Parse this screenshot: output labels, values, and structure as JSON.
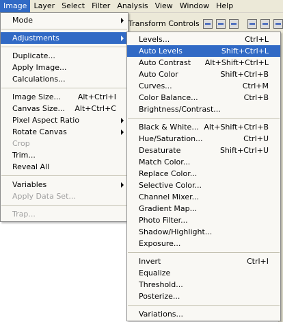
{
  "menubar": [
    {
      "label": "Image",
      "active": true
    },
    {
      "label": "Layer"
    },
    {
      "label": "Select"
    },
    {
      "label": "Filter"
    },
    {
      "label": "Analysis"
    },
    {
      "label": "View"
    },
    {
      "label": "Window"
    },
    {
      "label": "Help"
    }
  ],
  "toolbar": {
    "transform_label": "Transform Controls"
  },
  "image_menu": [
    {
      "label": "Mode",
      "arrow": true
    },
    {
      "sep": true
    },
    {
      "label": "Adjustments",
      "arrow": true,
      "highlight": true
    },
    {
      "sep": true
    },
    {
      "label": "Duplicate..."
    },
    {
      "label": "Apply Image..."
    },
    {
      "label": "Calculations..."
    },
    {
      "sep": true
    },
    {
      "label": "Image Size...",
      "shortcut": "Alt+Ctrl+I"
    },
    {
      "label": "Canvas Size...",
      "shortcut": "Alt+Ctrl+C"
    },
    {
      "label": "Pixel Aspect Ratio",
      "arrow": true
    },
    {
      "label": "Rotate Canvas",
      "arrow": true
    },
    {
      "label": "Crop",
      "disabled": true
    },
    {
      "label": "Trim..."
    },
    {
      "label": "Reveal All"
    },
    {
      "sep": true
    },
    {
      "label": "Variables",
      "arrow": true
    },
    {
      "label": "Apply Data Set...",
      "disabled": true
    },
    {
      "sep": true
    },
    {
      "label": "Trap...",
      "disabled": true
    }
  ],
  "adjust_menu": [
    {
      "label": "Levels...",
      "shortcut": "Ctrl+L"
    },
    {
      "label": "Auto Levels",
      "shortcut": "Shift+Ctrl+L",
      "highlight": true
    },
    {
      "label": "Auto Contrast",
      "shortcut": "Alt+Shift+Ctrl+L"
    },
    {
      "label": "Auto Color",
      "shortcut": "Shift+Ctrl+B"
    },
    {
      "label": "Curves...",
      "shortcut": "Ctrl+M"
    },
    {
      "label": "Color Balance...",
      "shortcut": "Ctrl+B"
    },
    {
      "label": "Brightness/Contrast..."
    },
    {
      "sep": true
    },
    {
      "label": "Black & White...",
      "shortcut": "Alt+Shift+Ctrl+B"
    },
    {
      "label": "Hue/Saturation...",
      "shortcut": "Ctrl+U"
    },
    {
      "label": "Desaturate",
      "shortcut": "Shift+Ctrl+U"
    },
    {
      "label": "Match Color..."
    },
    {
      "label": "Replace Color..."
    },
    {
      "label": "Selective Color..."
    },
    {
      "label": "Channel Mixer..."
    },
    {
      "label": "Gradient Map..."
    },
    {
      "label": "Photo Filter..."
    },
    {
      "label": "Shadow/Highlight..."
    },
    {
      "label": "Exposure..."
    },
    {
      "sep": true
    },
    {
      "label": "Invert",
      "shortcut": "Ctrl+I"
    },
    {
      "label": "Equalize"
    },
    {
      "label": "Threshold..."
    },
    {
      "label": "Posterize..."
    },
    {
      "sep": true
    },
    {
      "label": "Variations..."
    }
  ],
  "colors": {
    "highlight": "#316ac5",
    "menubar_bg": "#ece9d8",
    "menu_bg": "#f9f8f4",
    "disabled": "#a0a0a0"
  }
}
